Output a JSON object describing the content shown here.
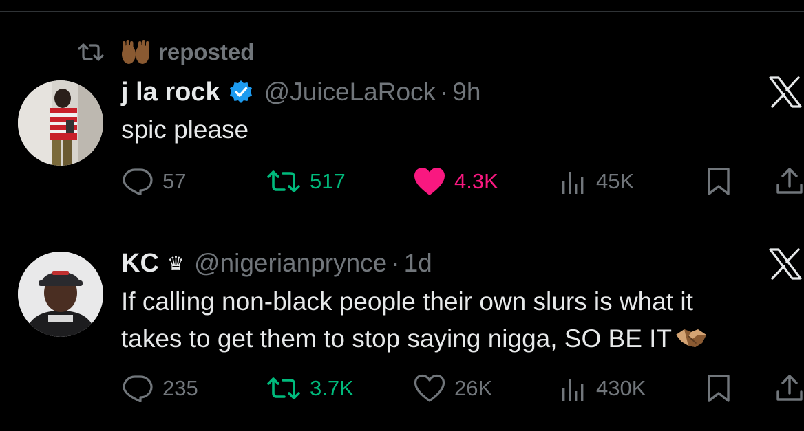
{
  "posts": [
    {
      "social_context": {
        "icon": "retweet-icon",
        "emoji": "raised-hands-emoji",
        "label": "reposted"
      },
      "name": "j la rock",
      "verified": true,
      "handle": "@JuiceLaRock",
      "separator": "·",
      "time": "9h",
      "text": "spic please",
      "stats": {
        "replies": "57",
        "reposts": "517",
        "likes": "4.3K",
        "views": "45K"
      },
      "liked": true,
      "colors": {
        "like_active": "#f91880",
        "repost": "#00ba7c",
        "muted": "#71767b"
      }
    },
    {
      "name": "KC",
      "badge": "♛",
      "handle": "@nigerianprynce",
      "separator": "·",
      "time": "1d",
      "text_line1": "If calling non-black people their own slurs is what it",
      "text_line2": "takes to get them to stop saying nigga, SO BE IT",
      "trailing_emoji": "handshake-emoji",
      "stats": {
        "replies": "235",
        "reposts": "3.7K",
        "likes": "26K",
        "views": "430K"
      },
      "liked": false
    }
  ]
}
